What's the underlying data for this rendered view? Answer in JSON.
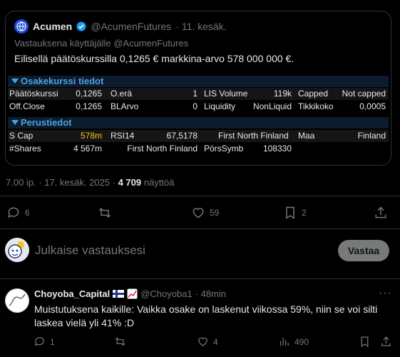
{
  "quote": {
    "author_name": "Acumen",
    "author_handle": "@AcumenFutures",
    "author_date": "· 11. kesäk.",
    "reply_to": "Vastauksena käyttäjälle @AcumenFutures",
    "text": "Eilisellä päätöskurssilla 0,1265 € markkina-arvo 578 000 000 €."
  },
  "terminal": {
    "section1_title": "Osakekurssi tiedot",
    "row1": [
      "Päätöskurssi",
      "0,1265",
      "O.erä",
      "1",
      "LIS Volume",
      "119k",
      "Capped",
      "Not capped"
    ],
    "row2": [
      "Off.Close",
      "0,1265",
      "BLArvo",
      "0",
      "Liquidity",
      "NonLiquid",
      "Tikkikoko",
      "0,0005"
    ],
    "section2_title": "Perustiedot",
    "row3": [
      "S Cap",
      "578m",
      "RSI14",
      "67,5178",
      "First North Finland",
      "Maa",
      "Finland"
    ],
    "row4": [
      "#Shares",
      "4 567m",
      "First North Finland",
      "PörsSymb",
      "108330"
    ]
  },
  "post": {
    "time": "7.00 ip. · 17. kesäk. 2025 ·",
    "views_count": "4 709",
    "views_label": "näyttöä",
    "replies": "6",
    "likes": "59",
    "bookmarks": "2"
  },
  "compose": {
    "placeholder": "Julkaise vastauksesi",
    "button": "Vastaa"
  },
  "reply": {
    "name": "Choyoba_Capital",
    "handle": "@Choyoba1",
    "time": "· 48min",
    "text": "Muistutuksena kaikille: Vaikka osake on laskenut viikossa 59%, niin se voi silti laskea vielä yli 41% :D",
    "replies": "1",
    "likes": "4",
    "views": "490"
  },
  "colors": {
    "accent_blue": "#1d9bf0",
    "terminal_header": "#4aa3df",
    "highlight_yellow": "#f5c518",
    "muted_text": "#71767b"
  }
}
